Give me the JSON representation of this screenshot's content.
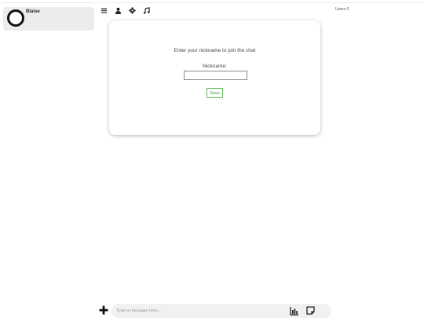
{
  "user": {
    "name": "Blaise"
  },
  "toolbar": {
    "icons": [
      "menu-icon",
      "user-icon",
      "gear-icon",
      "music-icon"
    ]
  },
  "users_count": "Users 0",
  "modal": {
    "prompt": "Enter your nickname to join the chat",
    "nickname_label": "Nickname:",
    "nickname_value": "",
    "save_label": "Save"
  },
  "composer": {
    "placeholder": "Type a message here...",
    "icons": [
      "plus-icon",
      "chart-icon",
      "sticky-note-icon"
    ]
  },
  "colors": {
    "save_accent": "#5cb85c",
    "card_bg": "#ececec",
    "composer_bg": "#f1f1f1"
  }
}
